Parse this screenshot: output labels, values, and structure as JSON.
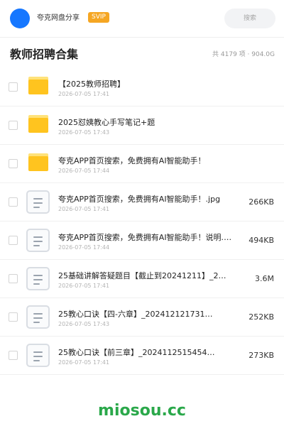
{
  "topbar": {
    "share_name": "夸克网盘分享",
    "badge": "SVIP",
    "search_placeholder": "搜索"
  },
  "header": {
    "title": "教师招聘合集",
    "stats": "共 4179 项 · 904.0G"
  },
  "items": [
    {
      "type": "folder",
      "name": "【2025教师招聘】",
      "date": "2026-07-05 17:41",
      "size": ""
    },
    {
      "type": "folder",
      "name": "2025怼姨教心手写笔记+题",
      "date": "2026-07-05 17:43",
      "size": ""
    },
    {
      "type": "folder",
      "name": "夸克APP首页搜索，免费拥有AI智能助手！",
      "date": "2026-07-05 17:44",
      "size": ""
    },
    {
      "type": "file",
      "name": "夸克APP首页搜索，免费拥有AI智能助手！.jpg",
      "date": "2026-07-05 17:41",
      "size": "266KB"
    },
    {
      "type": "file",
      "name": "夸克APP首页搜索，免费拥有AI智能助手！说明.p…",
      "date": "2026-07-05 17:44",
      "size": "494KB"
    },
    {
      "type": "file",
      "name": "25基础讲解答疑题目【截止到20241211】_2…",
      "date": "2026-07-05 17:41",
      "size": "3.6M"
    },
    {
      "type": "file",
      "name": "25教心口诀【四-六章】_202412121731…",
      "date": "2026-07-05 17:43",
      "size": "252KB"
    },
    {
      "type": "file",
      "name": "25教心口诀【前三章】_2024112515454…",
      "date": "2026-07-05 17:41",
      "size": "273KB"
    }
  ],
  "watermark": "miosou.cc",
  "colors": {
    "avatar": "#1677ff",
    "badge": "#f5a623",
    "folder": "#ffc41f",
    "watermark": "#2aa84a"
  }
}
